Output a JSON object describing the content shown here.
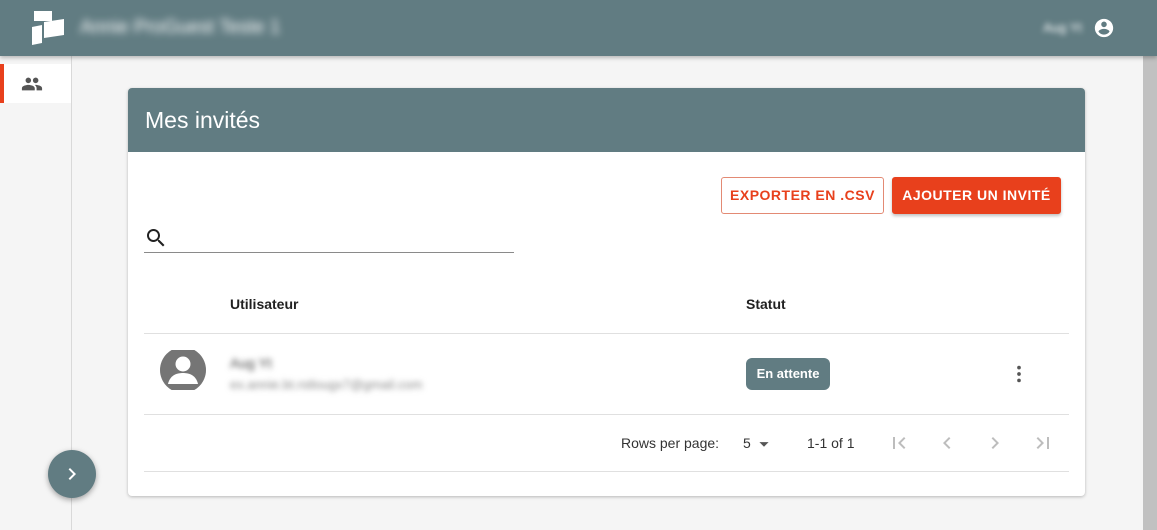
{
  "header": {
    "app_title": "Annie ProGuest Teste 1",
    "user_name": "Aug Yt"
  },
  "sidebar": {
    "items": [
      {
        "label": "Invités",
        "icon": "people-icon",
        "active": true
      }
    ]
  },
  "card": {
    "title": "Mes invités",
    "export_label": "EXPORTER EN .CSV",
    "add_label": "AJOUTER UN INVITÉ",
    "search_placeholder": "",
    "columns": [
      "Utilisateur",
      "Statut"
    ],
    "rows": [
      {
        "name": "Aug Yt",
        "email": "ex.annie.bt.rstlougx7@gmail.com",
        "status": "En attente"
      }
    ],
    "pagination": {
      "rows_per_page_label": "Rows per page:",
      "rows_per_page_value": "5",
      "range": "1-1 of 1"
    }
  },
  "colors": {
    "primary": "#617c82",
    "accent": "#e8401c",
    "background": "#f5f5f5"
  }
}
